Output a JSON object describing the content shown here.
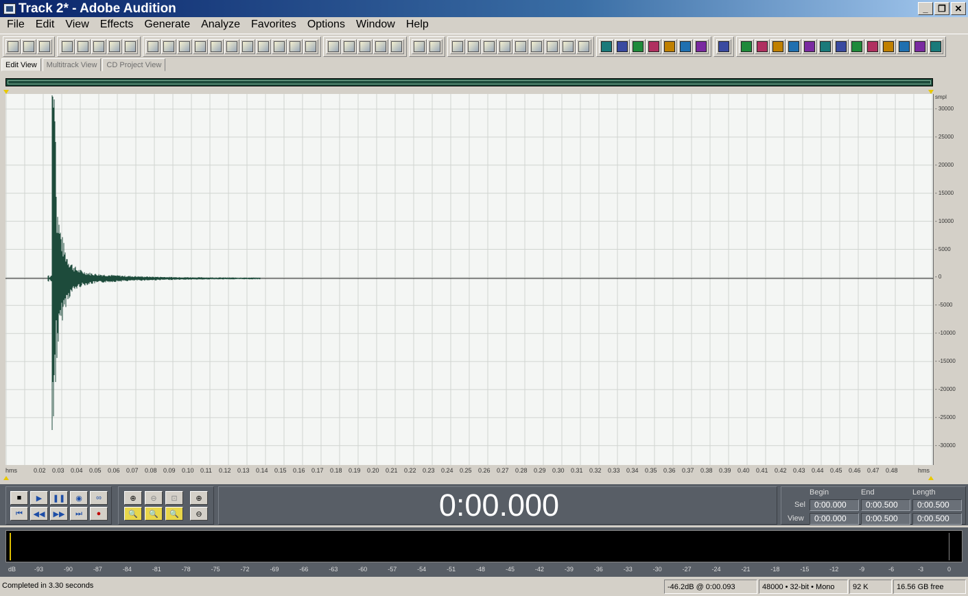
{
  "window": {
    "title": "Track 2* - Adobe Audition"
  },
  "menu": [
    "File",
    "Edit",
    "View",
    "Effects",
    "Generate",
    "Analyze",
    "Favorites",
    "Options",
    "Window",
    "Help"
  ],
  "toolbar_icons": [
    [
      "waveform-edit-icon",
      "multitrack-icon",
      "cd-icon"
    ],
    [
      "new-file-icon",
      "open-file-icon",
      "save-icon",
      "save-as-icon",
      "save-all-icon"
    ],
    [
      "undo-icon",
      "redo-icon",
      "repeat-icon",
      "trim-icon",
      "copy-icon",
      "cut-icon",
      "paste-icon",
      "paste-new-icon",
      "mix-paste-icon",
      "loop-icon",
      "convert-icon"
    ],
    [
      "envelope-icon",
      "normalize-icon",
      "grid-icon",
      "grid2-icon",
      "grid3-icon"
    ],
    [
      "cursor-icon",
      "marquee-icon"
    ],
    [
      "window1-icon",
      "window2-icon",
      "window3-icon",
      "play-icon",
      "zoom-icon",
      "time-display-icon",
      "bars-icon",
      "frequency-icon",
      "spectral-icon"
    ],
    [
      "fx1-icon",
      "fx2-icon",
      "fx3-icon",
      "fx4-icon",
      "fx5-icon",
      "fx6-icon",
      "fx7-icon"
    ],
    [
      "analyzer-icon"
    ],
    [
      "ana1-icon",
      "ana2-icon",
      "ana3-icon",
      "ana4-icon",
      "ana5-icon",
      "ana6-icon",
      "ana7-icon",
      "ana8-icon",
      "ana9-icon",
      "ana10-icon",
      "ana11-icon",
      "ana12-icon",
      "ana13-icon"
    ]
  ],
  "tabs": {
    "edit": "Edit View",
    "multitrack": "Multitrack View",
    "cd": "CD Project View"
  },
  "axes": {
    "y_unit": "smpl",
    "y_ticks": [
      "30000",
      "25000",
      "20000",
      "15000",
      "10000",
      "5000",
      "0",
      "-5000",
      "-10000",
      "-15000",
      "-20000",
      "-25000",
      "-30000"
    ],
    "x_unit_left": "hms",
    "x_unit_right": "hms",
    "x_ticks": [
      "0.02",
      "0.03",
      "0.04",
      "0.05",
      "0.06",
      "0.07",
      "0.08",
      "0.09",
      "0.10",
      "0.11",
      "0.12",
      "0.13",
      "0.14",
      "0.15",
      "0.16",
      "0.17",
      "0.18",
      "0.19",
      "0.20",
      "0.21",
      "0.22",
      "0.23",
      "0.24",
      "0.25",
      "0.26",
      "0.27",
      "0.28",
      "0.29",
      "0.30",
      "0.31",
      "0.32",
      "0.33",
      "0.34",
      "0.35",
      "0.36",
      "0.37",
      "0.38",
      "0.39",
      "0.40",
      "0.41",
      "0.42",
      "0.43",
      "0.44",
      "0.45",
      "0.46",
      "0.47",
      "0.48"
    ]
  },
  "transport": {
    "time": "0:00.000",
    "buttons": [
      "stop",
      "play",
      "pause",
      "play-looped",
      "loop-continuous",
      "go-to-beginning",
      "rewind",
      "fast-forward",
      "go-to-end",
      "record"
    ],
    "zoom_buttons": [
      "zoom-in-horizontal",
      "zoom-out-horizontal",
      "zoom-full",
      "zoom-in-vertical",
      "zoom-left",
      "zoom-right",
      "zoom-selection",
      "zoom-out-vertical"
    ]
  },
  "selection": {
    "headers": {
      "begin": "Begin",
      "end": "End",
      "length": "Length"
    },
    "sel_label": "Sel",
    "view_label": "View",
    "sel": {
      "begin": "0:00.000",
      "end": "0:00.500",
      "length": "0:00.500"
    },
    "view": {
      "begin": "0:00.000",
      "end": "0:00.500",
      "length": "0:00.500"
    }
  },
  "meter": {
    "scale": [
      "dB",
      "-93",
      "-90",
      "-87",
      "-84",
      "-81",
      "-78",
      "-75",
      "-72",
      "-69",
      "-66",
      "-63",
      "-60",
      "-57",
      "-54",
      "-51",
      "-48",
      "-45",
      "-42",
      "-39",
      "-36",
      "-33",
      "-30",
      "-27",
      "-24",
      "-21",
      "-18",
      "-15",
      "-12",
      "-9",
      "-6",
      "-3",
      "0"
    ]
  },
  "status": {
    "message": "Completed in 3.30 seconds",
    "cursor": "-46.2dB @  0:00.093",
    "format": "48000 • 32-bit • Mono",
    "size": "92 K",
    "free": "16.56 GB free"
  },
  "colors": {
    "waveform": "#1d4b3b",
    "background": "#f4f6f4",
    "grid": "#d0d4d0",
    "transport": "#585e66"
  }
}
